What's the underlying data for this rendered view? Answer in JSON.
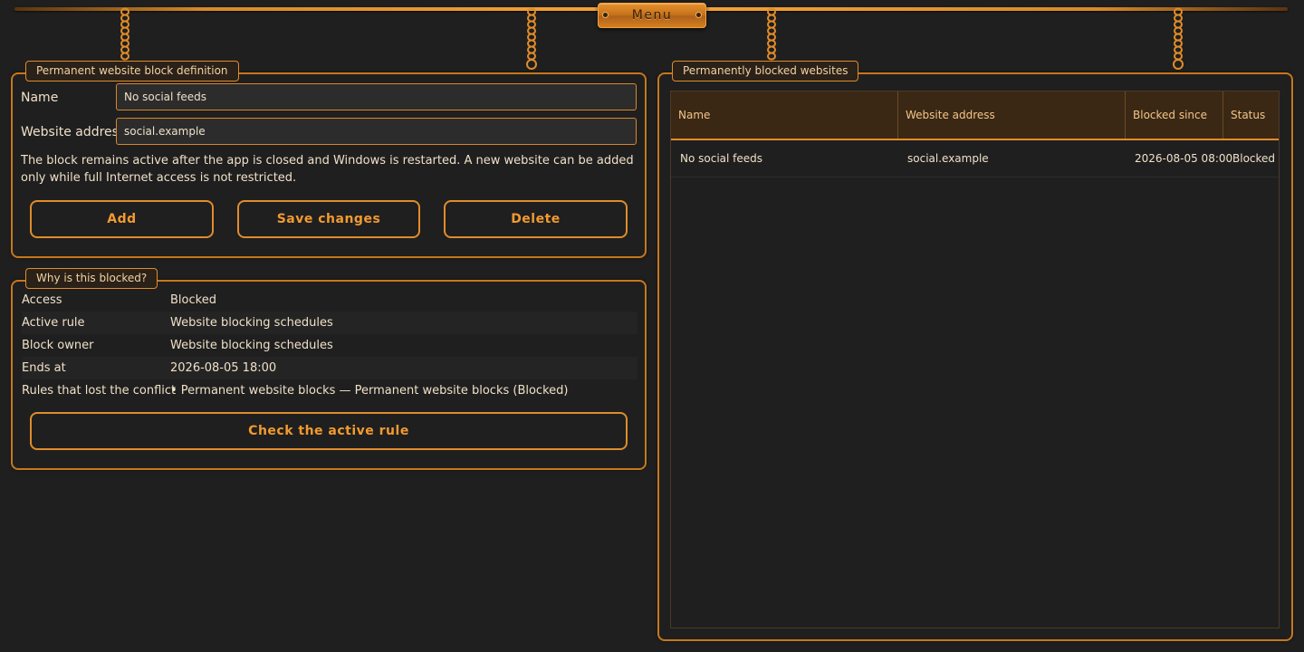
{
  "menu": {
    "label": "Menu"
  },
  "definition": {
    "title": "Permanent website block definition",
    "name_label": "Name",
    "name_value": "No social feeds",
    "address_label": "Website address",
    "address_value": "social.example",
    "note": "The block remains active after the app is closed and Windows is restarted. A new website can be added only while full Internet access is not restricted.",
    "add_label": "Add",
    "save_label": "Save changes",
    "delete_label": "Delete"
  },
  "why": {
    "title": "Why is this blocked?",
    "rows": [
      {
        "key": "Access",
        "value": "Blocked"
      },
      {
        "key": "Active rule",
        "value": "Website blocking schedules"
      },
      {
        "key": "Block owner",
        "value": "Website blocking schedules"
      },
      {
        "key": "Ends at",
        "value": "2026-08-05 18:00"
      },
      {
        "key": "Rules that lost the conflict",
        "value": "• Permanent website blocks — Permanent website blocks (Blocked)"
      }
    ],
    "check_label": "Check the active rule"
  },
  "blocked_list": {
    "title": "Permanently blocked websites",
    "columns": [
      "Name",
      "Website address",
      "Blocked since",
      "Status"
    ],
    "rows": [
      {
        "name": "No social feeds",
        "address": "social.example",
        "since": "2026-08-05 08:00",
        "status": "Blocked"
      }
    ]
  },
  "colors": {
    "background": "#1f1f1f",
    "accent": "#e08c2a",
    "accent_text": "#f29a30",
    "text": "#f0e0c8",
    "header_bg": "#3a2814"
  }
}
